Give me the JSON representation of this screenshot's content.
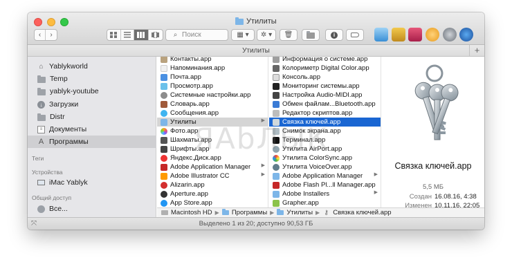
{
  "window": {
    "title": "Утилиты"
  },
  "toolbar": {
    "back": "‹",
    "forward": "›",
    "search_placeholder": "Поиск"
  },
  "tab_bar": {
    "label": "Утилиты",
    "add": "+"
  },
  "sidebar": {
    "favorites": [
      {
        "label": "Yablykworld",
        "icon": "home-icon"
      },
      {
        "label": "Temp",
        "icon": "folder-icon"
      },
      {
        "label": "yablyk-youtube",
        "icon": "folder-icon"
      },
      {
        "label": "Загрузки",
        "icon": "downloads-icon"
      },
      {
        "label": "Distr",
        "icon": "folder-icon"
      },
      {
        "label": "Документы",
        "icon": "documents-icon"
      },
      {
        "label": "Программы",
        "icon": "applications-icon"
      }
    ],
    "tags_header": "Теги",
    "devices_header": "Устройства",
    "devices": [
      {
        "label": "iMac Yablyk",
        "icon": "imac-icon"
      }
    ],
    "shared_header": "Общий доступ",
    "shared": [
      {
        "label": "Все...",
        "icon": "network-icon"
      }
    ]
  },
  "column1": [
    {
      "label": "Контакты.app"
    },
    {
      "label": "Напоминания.app"
    },
    {
      "label": "Почта.app"
    },
    {
      "label": "Просмотр.app"
    },
    {
      "label": "Системные настройки.app"
    },
    {
      "label": "Словарь.app"
    },
    {
      "label": "Сообщения.app"
    },
    {
      "label": "Утилиты"
    },
    {
      "label": "Фото.app"
    },
    {
      "label": "Шахматы.app"
    },
    {
      "label": "Шрифты.app"
    },
    {
      "label": "Яндекс.Диск.app"
    },
    {
      "label": "Adobe Application Manager"
    },
    {
      "label": "Adobe Illustrator CC"
    },
    {
      "label": "Alizarin.app"
    },
    {
      "label": "Aperture.app"
    },
    {
      "label": "App Store.app"
    }
  ],
  "column2": [
    {
      "label": "Информация о системе.app"
    },
    {
      "label": "Колориметр Digital Color.app"
    },
    {
      "label": "Консоль.app"
    },
    {
      "label": "Мониторинг системы.app"
    },
    {
      "label": "Настройка Audio-MIDI.app"
    },
    {
      "label": "Обмен файлам...Bluetooth.app"
    },
    {
      "label": "Редактор скриптов.app"
    },
    {
      "label": "Связка ключей.app"
    },
    {
      "label": "Снимок экрана.app"
    },
    {
      "label": "Терминал.app"
    },
    {
      "label": "Утилита AirPort.app"
    },
    {
      "label": "Утилита ColorSync.app"
    },
    {
      "label": "Утилита VoiceOver.app"
    },
    {
      "label": "Adobe Application Manager"
    },
    {
      "label": "Adobe Flash Pl...ll Manager.app"
    },
    {
      "label": "Adobe Installers"
    },
    {
      "label": "Grapher.app"
    }
  ],
  "preview": {
    "name": "Связка ключей.app",
    "size": "5,5 МБ",
    "created_label": "Создан",
    "created_value": "16.08.16, 4:38",
    "modified_label": "Изменен",
    "modified_value": "10.11.16, 22:05"
  },
  "path_bar": [
    {
      "label": "Macintosh HD"
    },
    {
      "label": "Программы"
    },
    {
      "label": "Утилиты"
    },
    {
      "label": "Связка ключей.app"
    }
  ],
  "status": {
    "text": "Выделено 1 из 20; доступно 90,53 ГБ"
  },
  "watermark": "ЯАbЛЫК"
}
